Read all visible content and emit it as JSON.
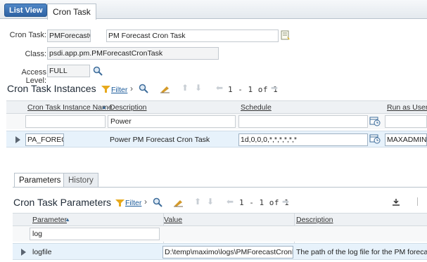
{
  "top": {
    "list_view": "List View",
    "tab": "Cron Task"
  },
  "form": {
    "cron_task_label": "Cron Task:",
    "cron_task_value": "PMForecastCr",
    "cron_task_description": "PM Forecast Cron Task",
    "class_label": "Class:",
    "class_value": "psdi.app.pm.PMForecastCronTask",
    "access_label": "Access Level:",
    "access_value": "FULL"
  },
  "instances": {
    "title": "Cron Task Instances",
    "filter": "Filter",
    "pager": "1 - 1 of 1",
    "columns": [
      "Cron Task Instance Name",
      "Description",
      "Schedule",
      "Run as User"
    ],
    "filter_values": {
      "name": "",
      "description": "Power",
      "schedule": "",
      "runas": ""
    },
    "row": {
      "name": "PA_FOREC",
      "description": "Power PM Forecast Cron Task",
      "schedule": "1d,0,0,0,*,*,*,*,*,*",
      "runas": "MAXADMIN"
    }
  },
  "subtabs": [
    "Parameters",
    "History"
  ],
  "parameters": {
    "title": "Cron Task Parameters",
    "filter": "Filter",
    "pager": "1 - 1 of 1",
    "columns": [
      "Parameter",
      "Value",
      "Description"
    ],
    "filter_values": {
      "parameter": "log"
    },
    "row": {
      "parameter": "logfile",
      "value": "D:\\temp\\maximo\\logs\\PMForecastCronPw.log",
      "description": "The path of the log file for the PM forecast crc"
    }
  }
}
